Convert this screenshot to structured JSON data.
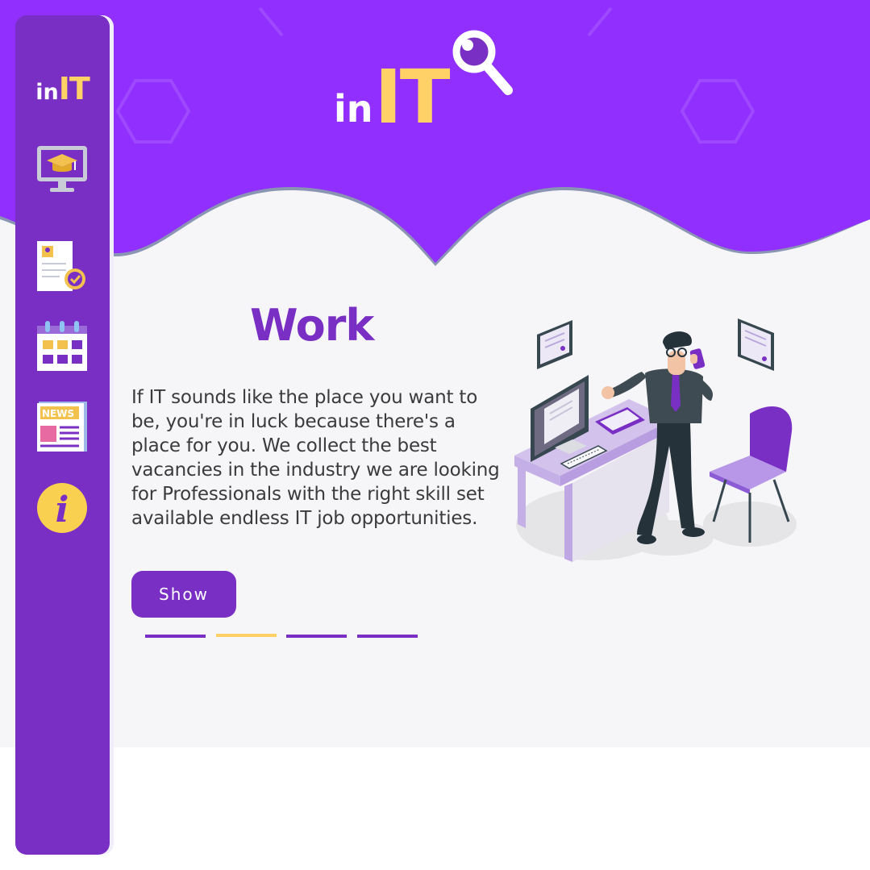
{
  "brand": {
    "prefix": "in",
    "suffix": "IT"
  },
  "sidebar": {
    "logo": {
      "prefix": "in",
      "suffix": "IT"
    },
    "items": [
      {
        "name": "courses",
        "icon": "graduation-monitor-icon"
      },
      {
        "name": "resume",
        "icon": "resume-check-icon"
      },
      {
        "name": "calendar",
        "icon": "calendar-icon"
      },
      {
        "name": "news",
        "icon": "newspaper-icon",
        "badge": "NEWS"
      },
      {
        "name": "info",
        "icon": "info-icon",
        "badge": "i"
      }
    ]
  },
  "main": {
    "heading": "Work",
    "description": "If IT sounds like the place you want to be, you're in luck because there's a place for you. We collect the best vacancies in the industry we are looking for Professionals with the right skill set available endless IT job opportunities.",
    "show_label": "Show",
    "slides": {
      "count": 4,
      "active": 1
    }
  },
  "colors": {
    "primary": "#7a2fc4",
    "header": "#9130fe",
    "accent": "#ffd166",
    "background": "#f6f5f8"
  }
}
